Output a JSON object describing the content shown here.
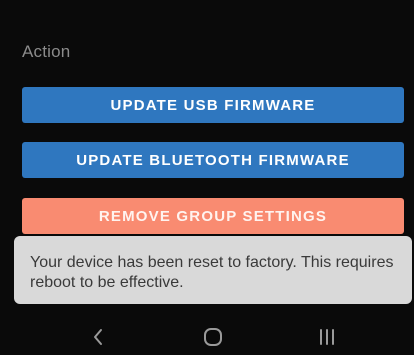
{
  "section": {
    "label": "Action"
  },
  "actions": {
    "update_usb_label": "UPDATE USB FIRMWARE",
    "update_bluetooth_label": "UPDATE BLUETOOTH FIRMWARE",
    "remove_group_label": "REMOVE GROUP SETTINGS"
  },
  "toast": {
    "message": "Your device has been reset to factory. This requires reboot to be effective."
  },
  "navbar": {
    "back_icon": "chevron-left-icon",
    "home_icon": "circle-home-icon",
    "recents_icon": "recents-bars-icon"
  },
  "colors": {
    "background": "#0a0a0a",
    "primary_button": "#2f77bf",
    "danger_button": "#f98b71",
    "toast_background": "#d9d9d9",
    "nav_icon": "#9a9a9a"
  }
}
